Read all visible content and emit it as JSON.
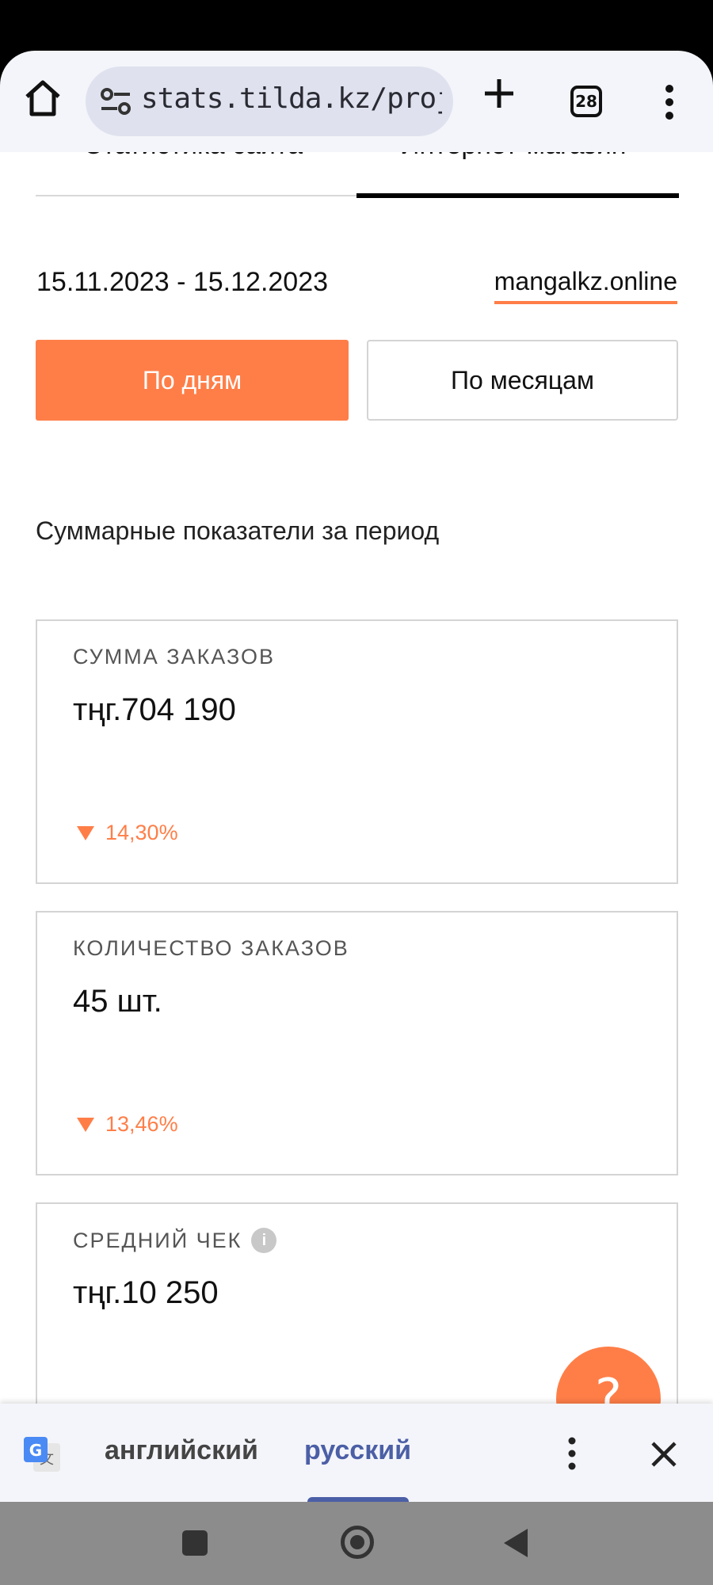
{
  "browser": {
    "url": "stats.tilda.kz/projects",
    "tab_count": "28"
  },
  "tabs": {
    "site_stats": "Статистика сайта",
    "online_store": "Интернет-магазин"
  },
  "filters": {
    "date_range": "15.11.2023 - 15.12.2023",
    "domain": "mangalkz.online",
    "by_days": "По дням",
    "by_months": "По месяцам"
  },
  "summary": {
    "title": "Суммарные показатели за период",
    "cards": [
      {
        "label": "СУММА ЗАКАЗОВ",
        "value": "тңг.704 190",
        "change": "14,30%"
      },
      {
        "label": "КОЛИЧЕСТВО ЗАКАЗОВ",
        "value": "45 шт.",
        "change": "13,46%"
      },
      {
        "label": "СРЕДНИЙ ЧЕК",
        "value": "тңг.10 250"
      }
    ]
  },
  "help": {
    "symbol": "?"
  },
  "translate": {
    "source_lang": "английский",
    "target_lang": "русский"
  },
  "colors": {
    "accent": "#ff7e48",
    "translate_active": "#4b5fa6"
  }
}
